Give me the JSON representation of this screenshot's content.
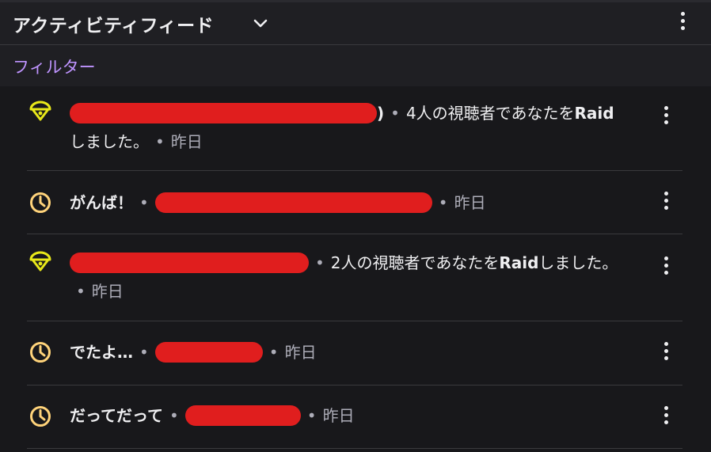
{
  "header": {
    "title": "アクティビティフィード"
  },
  "filter": {
    "label": "フィルター"
  },
  "colors": {
    "raid_icon": "#e8e81a",
    "timer_icon": "#ffd37a",
    "accent": "#bf94ff",
    "redaction": "#e01e1e"
  },
  "feed": {
    "separator": "•",
    "items": [
      {
        "type": "raid",
        "icon": "raid-icon",
        "name_suffix": ")",
        "message": "4人の視聴者であなたを",
        "message_bold": "Raid",
        "message_tail": "しました。",
        "time": "昨日"
      },
      {
        "type": "cheer",
        "icon": "timer-icon",
        "title": "がんば！",
        "time": "昨日"
      },
      {
        "type": "raid",
        "icon": "raid-icon",
        "message": "2人の視聴者であなたを",
        "message_bold": "Raid",
        "message_tail": "しました。",
        "time": "昨日"
      },
      {
        "type": "cheer",
        "icon": "timer-icon",
        "title": "でたよ…",
        "time": "昨日"
      },
      {
        "type": "cheer",
        "icon": "timer-icon",
        "title": "だってだって",
        "time": "昨日"
      }
    ]
  }
}
